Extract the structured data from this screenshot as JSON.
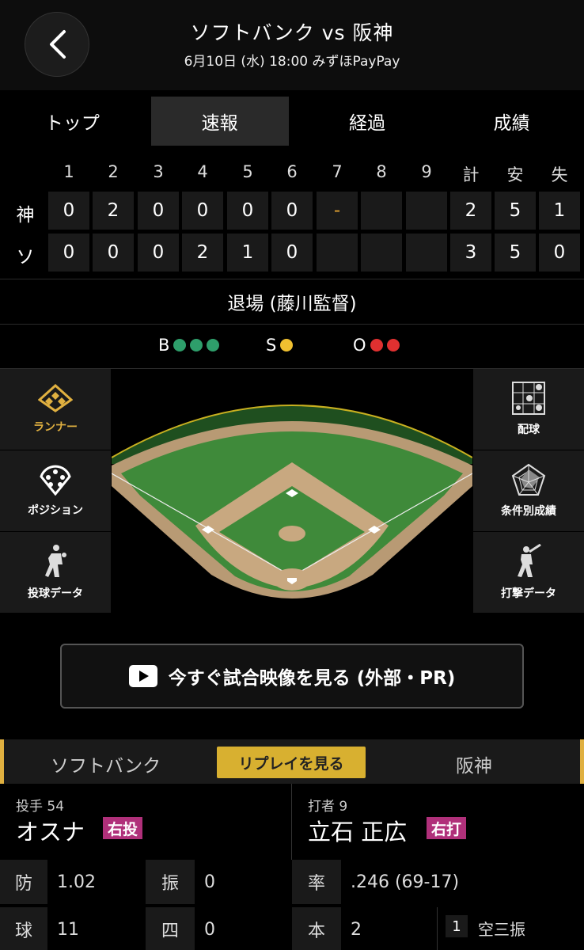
{
  "header": {
    "title": "ソフトバンク vs 阪神",
    "subtitle": "6月10日 (水) 18:00 みずほPayPay"
  },
  "tabs": [
    {
      "label": "トップ"
    },
    {
      "label": "速報"
    },
    {
      "label": "経過"
    },
    {
      "label": "成績"
    }
  ],
  "scoreboard": {
    "columns": [
      "1",
      "2",
      "3",
      "4",
      "5",
      "6",
      "7",
      "8",
      "9",
      "計",
      "安",
      "失"
    ],
    "rows": [
      {
        "team": "神",
        "innings": [
          "0",
          "2",
          "0",
          "0",
          "0",
          "0",
          "-",
          "",
          ""
        ],
        "totals": [
          "2",
          "5",
          "1"
        ]
      },
      {
        "team": "ソ",
        "innings": [
          "0",
          "0",
          "0",
          "2",
          "1",
          "0",
          "",
          "",
          ""
        ],
        "totals": [
          "3",
          "5",
          "0"
        ]
      }
    ]
  },
  "status_text": "退場 (藤川監督)",
  "count": {
    "b_label": "B",
    "balls": 3,
    "s_label": "S",
    "strikes": 1,
    "o_label": "O",
    "outs": 2,
    "colors": {
      "ball": "#2e9e6b",
      "strike": "#f0c030",
      "out": "#e03030"
    }
  },
  "side_menu": {
    "left": [
      {
        "label": "ランナー",
        "icon": "runner-diamond-icon"
      },
      {
        "label": "ポジション",
        "icon": "position-circle-icon"
      },
      {
        "label": "投球データ",
        "icon": "pitcher-icon"
      }
    ],
    "right": [
      {
        "label": "配球",
        "icon": "pitch-grid-icon"
      },
      {
        "label": "条件別成績",
        "icon": "radar-chart-icon"
      },
      {
        "label": "打撃データ",
        "icon": "batter-icon"
      }
    ]
  },
  "video_button": {
    "label": "今すぐ試合映像を見る (外部・PR)"
  },
  "team_bar": {
    "home_team": "ソフトバンク",
    "replay_label": "リプレイを見る",
    "away_team": "阪神",
    "accent": "#e0b040"
  },
  "pitcher": {
    "role": "投手 54",
    "name": "オスナ",
    "hand": "右投",
    "stats": [
      {
        "label": "防",
        "value": "1.02",
        "label2": "振",
        "value2": "0"
      },
      {
        "label": "球",
        "value": "11",
        "label2": "四",
        "value2": "0"
      }
    ]
  },
  "batter": {
    "role": "打者 9",
    "name": "立石 正広",
    "hand": "右打",
    "stats": [
      {
        "label": "率",
        "value": ".246 (69-17)"
      },
      {
        "label": "本",
        "value": "2"
      }
    ],
    "results": [
      {
        "num": "1",
        "text": "空三振"
      }
    ]
  }
}
